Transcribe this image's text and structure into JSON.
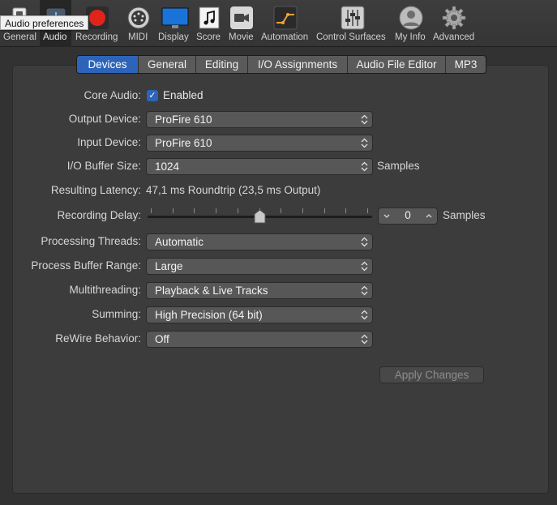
{
  "tooltip": "Audio preferences",
  "toolbar": {
    "items": [
      {
        "id": "general",
        "label": "General",
        "icon": "switch-icon"
      },
      {
        "id": "audio",
        "label": "Audio",
        "icon": "audio-interface-icon",
        "selected": true
      },
      {
        "id": "recording",
        "label": "Recording",
        "icon": "record-icon"
      },
      {
        "id": "midi",
        "label": "MIDI",
        "icon": "midi-connector-icon"
      },
      {
        "id": "display",
        "label": "Display",
        "icon": "monitor-icon"
      },
      {
        "id": "score",
        "label": "Score",
        "icon": "music-note-icon"
      },
      {
        "id": "movie",
        "label": "Movie",
        "icon": "video-camera-icon"
      },
      {
        "id": "automation",
        "label": "Automation",
        "icon": "automation-curve-icon"
      },
      {
        "id": "control_surfaces",
        "label": "Control Surfaces",
        "icon": "faders-icon"
      },
      {
        "id": "my_info",
        "label": "My Info",
        "icon": "user-icon"
      },
      {
        "id": "advanced",
        "label": "Advanced",
        "icon": "gear-icon"
      }
    ]
  },
  "tabs": [
    {
      "label": "Devices",
      "active": true
    },
    {
      "label": "General"
    },
    {
      "label": "Editing"
    },
    {
      "label": "I/O Assignments"
    },
    {
      "label": "Audio File Editor"
    },
    {
      "label": "MP3"
    }
  ],
  "devices": {
    "core_audio_label": "Core Audio:",
    "core_audio_checkbox": "Enabled",
    "core_audio_checked": true,
    "output_device_label": "Output Device:",
    "output_device_value": "ProFire 610",
    "input_device_label": "Input Device:",
    "input_device_value": "ProFire 610",
    "buffer_size_label": "I/O Buffer Size:",
    "buffer_size_value": "1024",
    "buffer_size_unit": "Samples",
    "latency_label": "Resulting Latency:",
    "latency_value": "47,1 ms Roundtrip (23,5 ms Output)",
    "recording_delay_label": "Recording Delay:",
    "recording_delay_value": "0",
    "recording_delay_unit": "Samples",
    "recording_delay_slider_fraction": 0.5,
    "processing_threads_label": "Processing Threads:",
    "processing_threads_value": "Automatic",
    "process_buffer_label": "Process Buffer Range:",
    "process_buffer_value": "Large",
    "multithreading_label": "Multithreading:",
    "multithreading_value": "Playback & Live Tracks",
    "summing_label": "Summing:",
    "summing_value": "High Precision (64 bit)",
    "rewire_label": "ReWire Behavior:",
    "rewire_value": "Off"
  },
  "apply_button": "Apply Changes",
  "colors": {
    "accent_blue": "#2d64b9",
    "record_red": "#e0241b",
    "automation_orange": "#f0a23a"
  }
}
